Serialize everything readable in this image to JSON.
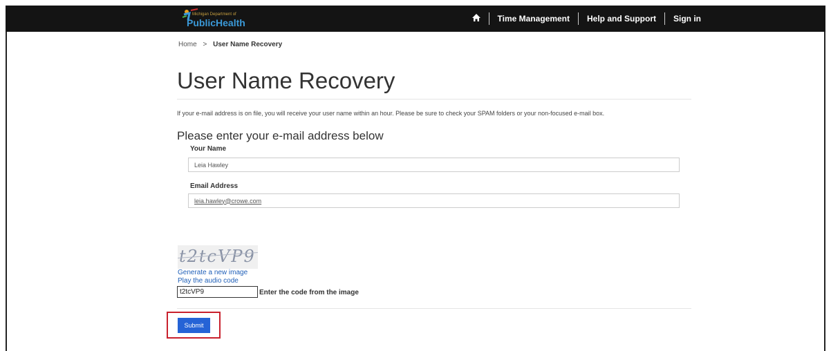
{
  "header": {
    "logo_small_text": "Michigan Department of",
    "logo_main_text": "PublicHealth",
    "nav": [
      "Time Management",
      "Help and Support",
      "Sign in"
    ]
  },
  "breadcrumb": {
    "home": "Home",
    "separator": ">",
    "current": "User Name Recovery"
  },
  "page": {
    "title": "User Name Recovery",
    "info": "If your e-mail address is on file, you will receive your user name within an hour. Please be sure to check your SPAM folders or your non-focused e-mail box.",
    "subheading": "Please enter your e-mail address below"
  },
  "form": {
    "name_label": "Your Name",
    "name_value": "Leia Hawley",
    "email_label": "Email Address",
    "email_value": "leia.hawley@crowe.com",
    "captcha_text": "t2tcVP9",
    "generate_link": "Generate a new image",
    "audio_link": "Play the audio code",
    "code_value": "t2tcVP9",
    "code_label": "Enter the code from the image",
    "submit_label": "Submit"
  },
  "colors": {
    "topbar": "#141414",
    "accent": "#2563d6",
    "highlight": "#c8202c",
    "link": "#1f5fb8"
  }
}
